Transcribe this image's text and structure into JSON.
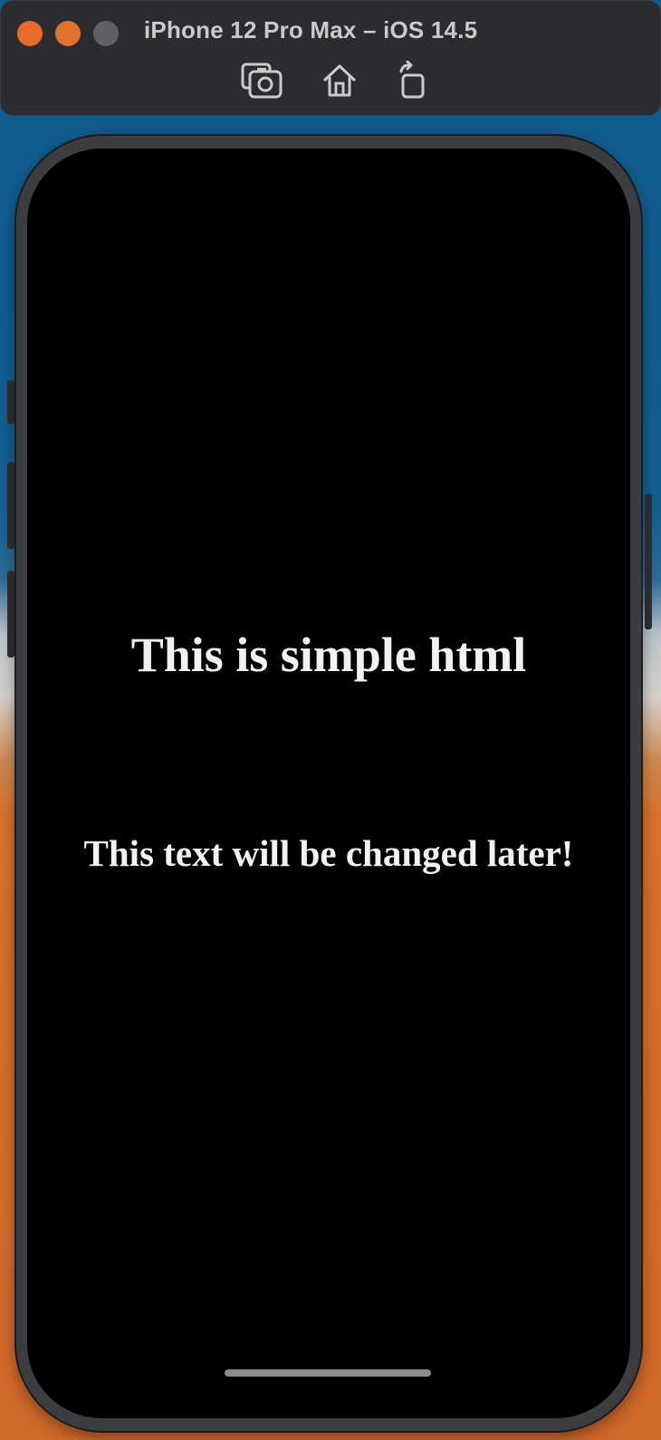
{
  "window": {
    "title": "iPhone 12 Pro Max – iOS 14.5"
  },
  "toolbar": {
    "buttons": [
      {
        "name": "screenshot",
        "icon": "camera-icon"
      },
      {
        "name": "home",
        "icon": "home-icon"
      },
      {
        "name": "rotate",
        "icon": "rotate-icon"
      }
    ]
  },
  "page": {
    "heading": "This is simple html",
    "paragraph": "This text will be changed later!"
  },
  "colors": {
    "titlebar": "#2b2c2f",
    "close": "#e56b26",
    "minimize": "#e2712c",
    "zoom": "#5e6064",
    "screen": "#000000",
    "text": "#f2f2f2"
  }
}
